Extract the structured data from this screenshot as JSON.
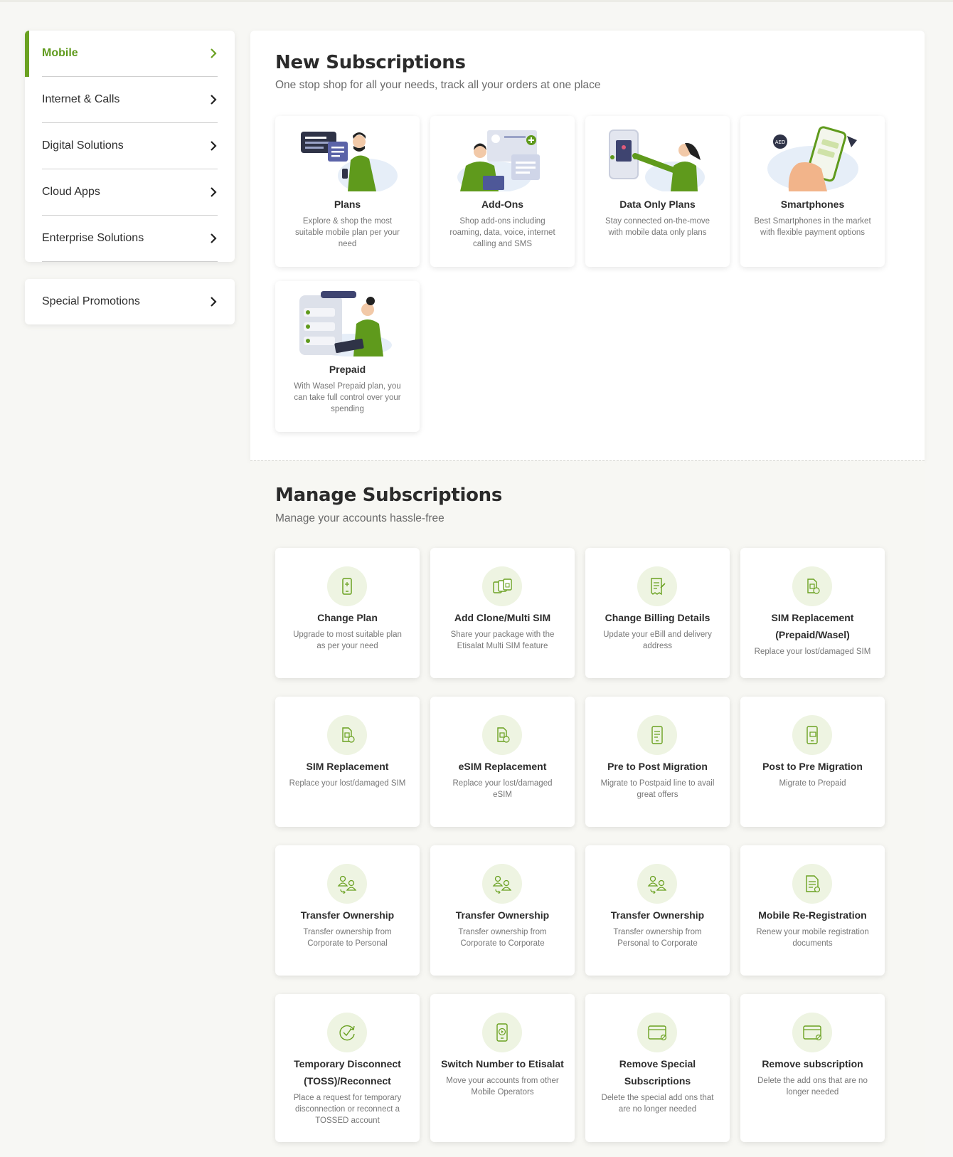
{
  "sidebar": {
    "items": [
      {
        "label": "Mobile"
      },
      {
        "label": "Internet & Calls"
      },
      {
        "label": "Digital Solutions"
      },
      {
        "label": "Cloud Apps"
      },
      {
        "label": "Enterprise Solutions"
      }
    ],
    "promo": {
      "label": "Special Promotions"
    }
  },
  "new_subscriptions": {
    "title": "New Subscriptions",
    "subtitle": "One stop shop for all your needs, track all your orders at one place",
    "cards": [
      {
        "title": "Plans",
        "desc": "Explore & shop the most suitable mobile plan per your need"
      },
      {
        "title": "Add-Ons",
        "desc": "Shop add-ons including roaming, data, voice, internet calling and SMS"
      },
      {
        "title": "Data Only Plans",
        "desc": "Stay connected on-the-move with mobile data only plans"
      },
      {
        "title": "Smartphones",
        "desc": "Best Smartphones in the market with flexible payment options"
      },
      {
        "title": "Prepaid",
        "desc": "With Wasel Prepaid plan, you can take full control over your spending"
      }
    ]
  },
  "manage_subscriptions": {
    "title": "Manage Subscriptions",
    "subtitle": "Manage your accounts hassle-free",
    "cards": [
      {
        "title": "Change Plan",
        "desc": "Upgrade to most suitable plan as per your need",
        "icon": "phone-icon"
      },
      {
        "title": "Add Clone/Multi SIM",
        "desc": "Share your package with the Etisalat Multi SIM feature",
        "icon": "multi-sim-icon"
      },
      {
        "title": "Change Billing Details",
        "desc": "Update your eBill and delivery address",
        "icon": "bill-icon"
      },
      {
        "title": "SIM Replacement (Prepaid/Wasel)",
        "desc": "Replace your lost/damaged SIM",
        "icon": "sim-replace-icon"
      },
      {
        "title": "SIM Replacement",
        "desc": "Replace your lost/damaged SIM",
        "icon": "sim-replace-icon"
      },
      {
        "title": "eSIM Replacement",
        "desc": "Replace your lost/damaged eSIM",
        "icon": "esim-icon"
      },
      {
        "title": "Pre to Post Migration",
        "desc": "Migrate to Postpaid line to avail great offers",
        "icon": "migration-icon"
      },
      {
        "title": "Post to Pre Migration",
        "desc": "Migrate to Prepaid",
        "icon": "migration-icon"
      },
      {
        "title": "Transfer Ownership",
        "desc": "Transfer ownership from Corporate to Personal",
        "icon": "transfer-users-icon"
      },
      {
        "title": "Transfer Ownership",
        "desc": "Transfer ownership from Corporate to Corporate",
        "icon": "transfer-users-icon"
      },
      {
        "title": "Transfer Ownership",
        "desc": "Transfer ownership from Personal to Corporate",
        "icon": "transfer-users-icon"
      },
      {
        "title": "Mobile Re-Registration",
        "desc": "Renew your mobile registration documents",
        "icon": "document-icon"
      },
      {
        "title": "Temporary Disconnect (TOSS)/Reconnect",
        "desc": "Place a request for temporary disconnection or reconnect a TOSSED account",
        "icon": "refresh-check-icon"
      },
      {
        "title": "Switch Number to Etisalat",
        "desc": "Move your accounts from other Mobile Operators",
        "icon": "switch-phone-icon"
      },
      {
        "title": "Remove Special Subscriptions",
        "desc": "Delete the special add ons that are no longer needed",
        "icon": "window-remove-icon"
      },
      {
        "title": "Remove subscription",
        "desc": "Delete the add ons that are no longer needed",
        "icon": "window-remove-icon"
      }
    ]
  },
  "colors": {
    "accent": "#6aa121",
    "accent_light": "#eef4e2"
  }
}
